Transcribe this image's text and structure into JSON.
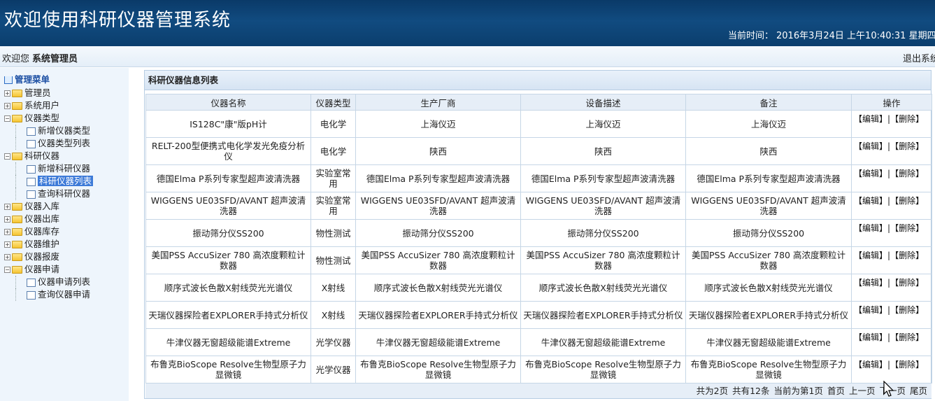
{
  "header": {
    "title": "欢迎使用科研仪器管理系统",
    "time_label": "当前时间：",
    "time_value": "2016年3月24日 上午10:40:31 星期四"
  },
  "welcome": {
    "greeting": "欢迎您",
    "user": "系统管理员",
    "logout": "退出系统"
  },
  "sidebar": {
    "root": "管理菜单",
    "groups": [
      {
        "label": "管理员",
        "expanded": false,
        "children": []
      },
      {
        "label": "系统用户",
        "expanded": false,
        "children": []
      },
      {
        "label": "仪器类型",
        "expanded": true,
        "children": [
          "新增仪器类型",
          "仪器类型列表"
        ]
      },
      {
        "label": "科研仪器",
        "expanded": true,
        "children": [
          "新增科研仪器",
          "科研仪器列表",
          "查询科研仪器"
        ]
      },
      {
        "label": "仪器入库",
        "expanded": false,
        "children": []
      },
      {
        "label": "仪器出库",
        "expanded": false,
        "children": []
      },
      {
        "label": "仪器库存",
        "expanded": false,
        "children": []
      },
      {
        "label": "仪器维护",
        "expanded": false,
        "children": []
      },
      {
        "label": "仪器报废",
        "expanded": false,
        "children": []
      },
      {
        "label": "仪器申请",
        "expanded": true,
        "children": [
          "仪器申请列表",
          "查询仪器申请"
        ]
      }
    ],
    "active_item": "科研仪器列表"
  },
  "main": {
    "panel_title": "科研仪器信息列表",
    "columns": [
      "仪器名称",
      "仪器类型",
      "生产厂商",
      "设备描述",
      "备注",
      "操作"
    ],
    "edit_label": "【编辑】",
    "separator": "|",
    "delete_label": "【删除】",
    "rows": [
      {
        "name": "IS128C\"康\"版pH计",
        "type": "电化学",
        "maker": "上海仪迈",
        "desc": "上海仪迈",
        "note": "上海仪迈"
      },
      {
        "name": "RELT-200型便携式电化学发光免疫分析仪",
        "type": "电化学",
        "maker": "陕西",
        "desc": "陕西",
        "note": "陕西"
      },
      {
        "name": "德国Elma P系列专家型超声波清洗器",
        "type": "实验室常用",
        "maker": "德国Elma P系列专家型超声波清洗器",
        "desc": "德国Elma P系列专家型超声波清洗器",
        "note": "德国Elma P系列专家型超声波清洗器"
      },
      {
        "name": "WIGGENS UE03SFD/AVANT 超声波清洗器",
        "type": "实验室常用",
        "maker": "WIGGENS UE03SFD/AVANT 超声波清洗器",
        "desc": "WIGGENS UE03SFD/AVANT 超声波清洗器",
        "note": "WIGGENS UE03SFD/AVANT 超声波清洗器"
      },
      {
        "name": "振动筛分仪SS200",
        "type": "物性测试",
        "maker": "振动筛分仪SS200",
        "desc": "振动筛分仪SS200",
        "note": "振动筛分仪SS200"
      },
      {
        "name": "美国PSS AccuSizer 780 高浓度颗粒计数器",
        "type": "物性测试",
        "maker": "美国PSS AccuSizer 780 高浓度颗粒计数器",
        "desc": "美国PSS AccuSizer 780 高浓度颗粒计数器",
        "note": "美国PSS AccuSizer 780 高浓度颗粒计数器"
      },
      {
        "name": "顺序式波长色散X射线荧光光谱仪",
        "type": "X射线",
        "maker": "顺序式波长色散X射线荧光光谱仪",
        "desc": "顺序式波长色散X射线荧光光谱仪",
        "note": "顺序式波长色散X射线荧光光谱仪"
      },
      {
        "name": "天瑞仪器探险者EXPLORER手持式分析仪",
        "type": "X射线",
        "maker": "天瑞仪器探险者EXPLORER手持式分析仪",
        "desc": "天瑞仪器探险者EXPLORER手持式分析仪",
        "note": "天瑞仪器探险者EXPLORER手持式分析仪"
      },
      {
        "name": "牛津仪器无窗超级能谱Extreme",
        "type": "光学仪器",
        "maker": "牛津仪器无窗超级能谱Extreme",
        "desc": "牛津仪器无窗超级能谱Extreme",
        "note": "牛津仪器无窗超级能谱Extreme"
      },
      {
        "name": "布鲁克BioScope Resolve生物型原子力显微镜",
        "type": "光学仪器",
        "maker": "布鲁克BioScope Resolve生物型原子力显微镜",
        "desc": "布鲁克BioScope Resolve生物型原子力显微镜",
        "note": "布鲁克BioScope Resolve生物型原子力显微镜"
      }
    ]
  },
  "pager": {
    "total_pages": "共为2页",
    "total_records": "共有12条",
    "current": "当前为第1页",
    "first": "首页",
    "prev": "上一页",
    "next": "下一页",
    "last": "尾页"
  }
}
